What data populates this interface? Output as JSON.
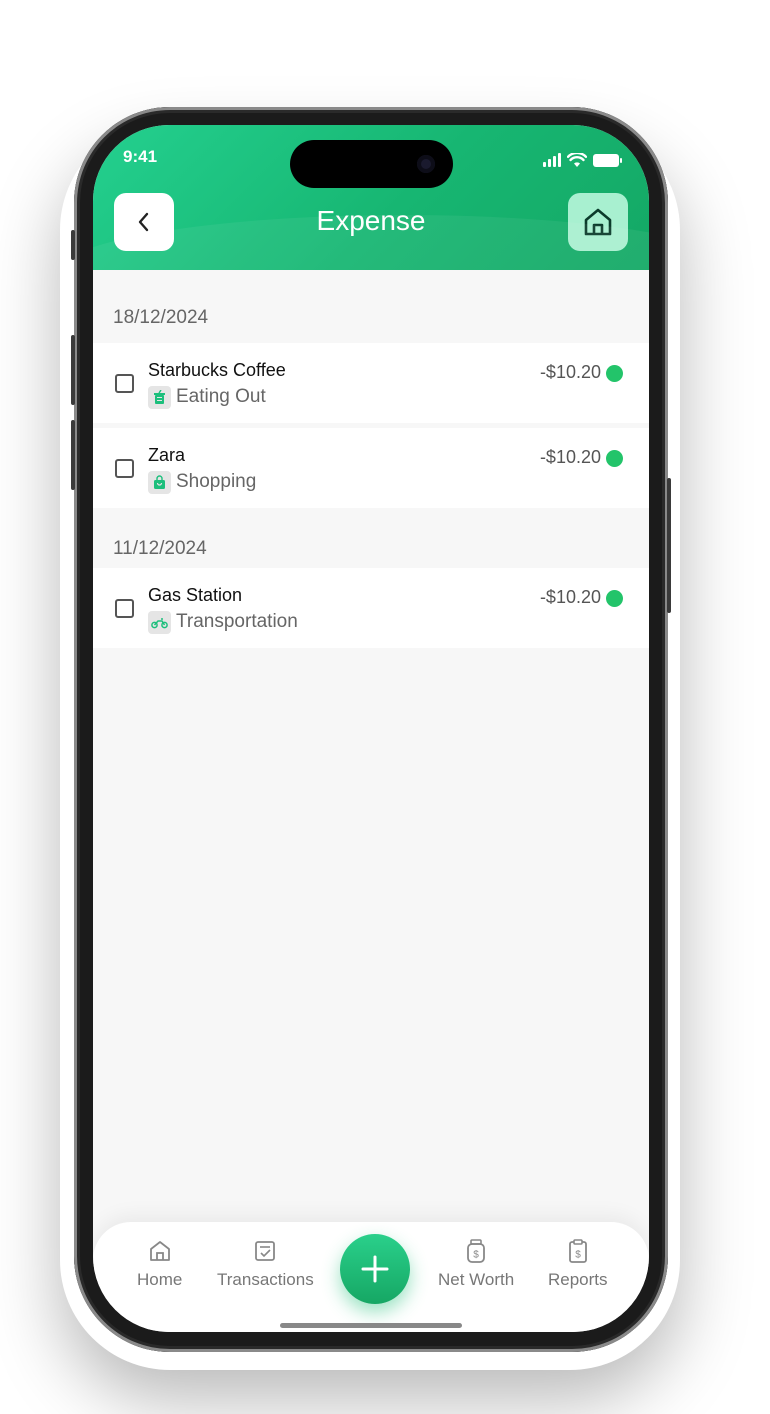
{
  "status_bar": {
    "time": "9:41"
  },
  "header": {
    "title": "Expense"
  },
  "groups": [
    {
      "date": "18/12/2024",
      "items": [
        {
          "name": "Starbucks Coffee",
          "category": "Eating Out",
          "category_icon": "cup-icon",
          "amount": "-$10.20",
          "status_color": "#23c46a"
        },
        {
          "name": "Zara",
          "category": "Shopping",
          "category_icon": "shopping-bag-icon",
          "amount": "-$10.20",
          "status_color": "#23c46a"
        }
      ]
    },
    {
      "date": "11/12/2024",
      "items": [
        {
          "name": "Gas Station",
          "category": "Transportation",
          "category_icon": "motorbike-icon",
          "amount": "-$10.20",
          "status_color": "#23c46a"
        }
      ]
    }
  ],
  "tabbar": {
    "home": "Home",
    "transactions": "Transactions",
    "net_worth": "Net Worth",
    "reports": "Reports"
  },
  "colors": {
    "accent": "#1cbf7c",
    "accent_light": "#a8f0d0"
  }
}
